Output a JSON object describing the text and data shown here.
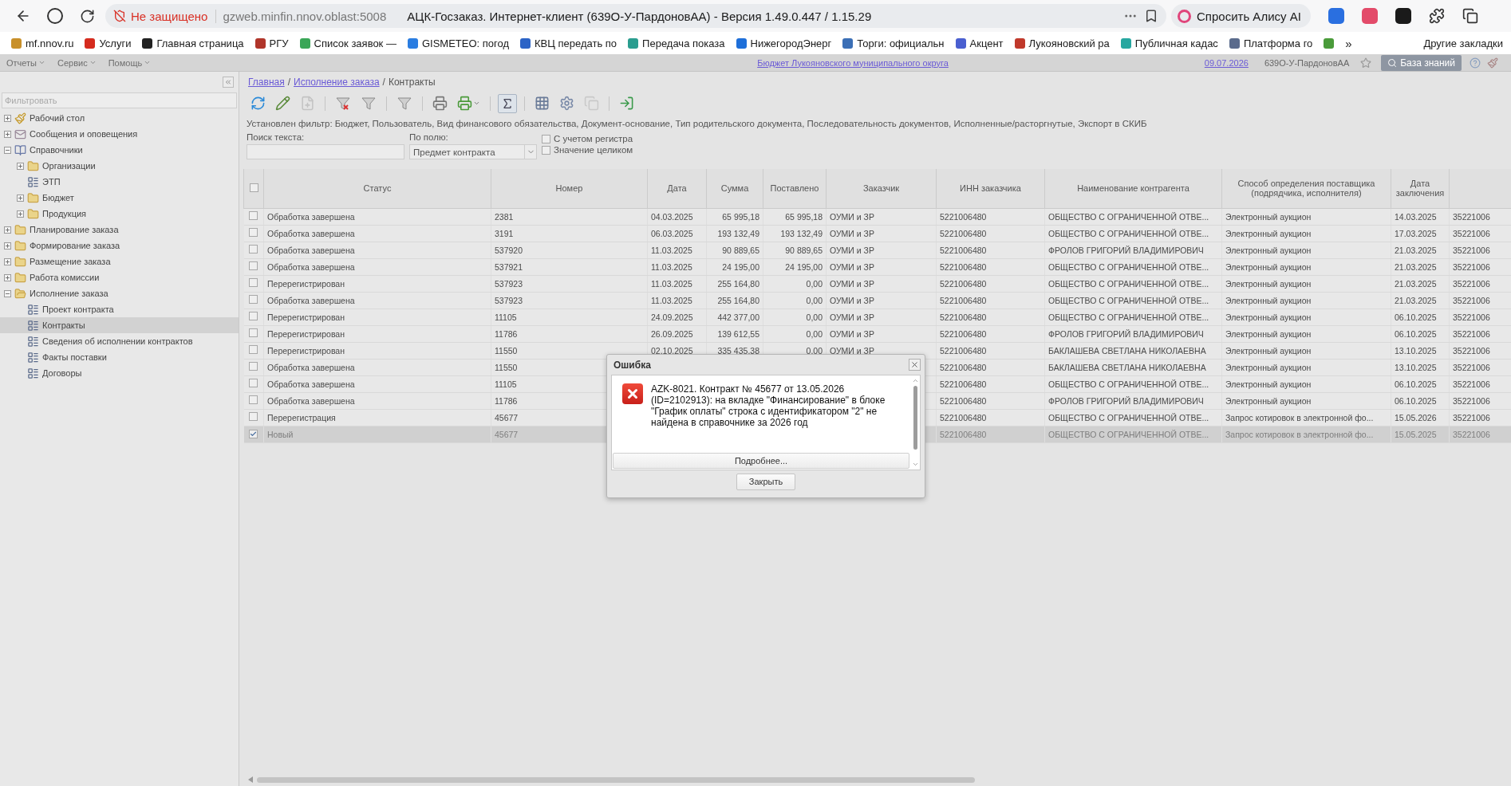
{
  "browser": {
    "security": "Не защищено",
    "url": "gzweb.minfin.nnov.oblast:5008",
    "title": "АЦК-Госзаказ. Интернет-клиент (639О-У-ПардоновАА) - Версия 1.49.0.447 / 1.15.29",
    "alice_button": "Спросить Алису AI"
  },
  "bookmarks": [
    {
      "label": "mf.nnov.ru",
      "color": "#c8902a"
    },
    {
      "label": "Услуги",
      "color": "#d52b1e"
    },
    {
      "label": "Главная страница",
      "color": "#222222"
    },
    {
      "label": "РГУ",
      "color": "#b0352a"
    },
    {
      "label": "Список заявок —",
      "color": "#3aa657"
    },
    {
      "label": "GISMETEO: погод",
      "color": "#2a7de1"
    },
    {
      "label": "КВЦ передать по",
      "color": "#2b63c6"
    },
    {
      "label": "Передача показа",
      "color": "#2a9d8f"
    },
    {
      "label": "НижегородЭнерг",
      "color": "#1e6fd9"
    },
    {
      "label": "Торги: официальн",
      "color": "#3b6fb6"
    },
    {
      "label": "Акцент",
      "color": "#4a5fd0"
    },
    {
      "label": "Лукояновский ра",
      "color": "#c0392b"
    },
    {
      "label": "Публичная кадас",
      "color": "#27a7a0"
    },
    {
      "label": "Платформа го",
      "color": "#5a6b8c"
    },
    {
      "color": "#4a9b3a"
    }
  ],
  "bookmarks_overflow": "»",
  "other_bookmarks": "Другие закладки",
  "menu": [
    {
      "label": "Отчеты"
    },
    {
      "label": "Сервис"
    },
    {
      "label": "Помощь"
    }
  ],
  "header": {
    "budget_link": "Бюджет Лукояновского муниципального округа",
    "date_link": "09.07.2026",
    "user": "639О-У-ПардоновАА",
    "knowledge_button": "База знаний"
  },
  "sidebar": {
    "filter_placeholder": "Фильтровать",
    "items": [
      {
        "label": "Рабочий стол",
        "kind": "desk",
        "expanded": false,
        "selected": false
      },
      {
        "label": "Сообщения и оповещения",
        "kind": "mail",
        "expanded": false,
        "selected": false
      },
      {
        "label": "Справочники",
        "kind": "books",
        "expanded": true,
        "selected": false,
        "children": [
          {
            "label": "Организации",
            "kind": "folder",
            "expanded": false,
            "selected": false
          },
          {
            "label": "ЭТП",
            "kind": "document",
            "selected": false
          },
          {
            "label": "Бюджет",
            "kind": "folder",
            "expanded": false,
            "selected": false
          },
          {
            "label": "Продукция",
            "kind": "folder",
            "expanded": false,
            "selected": false
          }
        ]
      },
      {
        "label": "Планирование заказа",
        "kind": "folder",
        "expanded": false,
        "selected": false
      },
      {
        "label": "Формирование заказа",
        "kind": "folder",
        "expanded": false,
        "selected": false
      },
      {
        "label": "Размещение заказа",
        "kind": "folder",
        "expanded": false,
        "selected": false
      },
      {
        "label": "Работа комиссии",
        "kind": "folder",
        "expanded": false,
        "selected": false
      },
      {
        "label": "Исполнение заказа",
        "kind": "folder",
        "expanded": true,
        "selected": false,
        "children": [
          {
            "label": "Проект контракта",
            "kind": "document",
            "selected": false
          },
          {
            "label": "Контракты",
            "kind": "document",
            "selected": true
          },
          {
            "label": "Сведения об исполнении контрактов",
            "kind": "document",
            "selected": false
          },
          {
            "label": "Факты поставки",
            "kind": "document",
            "selected": false
          },
          {
            "label": "Договоры",
            "kind": "document",
            "selected": false
          }
        ]
      }
    ]
  },
  "breadcrumb": [
    {
      "kind": "link",
      "label": "Главная"
    },
    {
      "kind": "separator",
      "label": "/"
    },
    {
      "kind": "link",
      "label": "Исполнение заказа"
    },
    {
      "kind": "separator",
      "label": "/"
    },
    {
      "kind": "current",
      "label": "Контракты"
    }
  ],
  "toolbar": [
    {
      "kind": "refresh",
      "disabled": false,
      "pressed": false
    },
    {
      "kind": "edit",
      "disabled": false,
      "pressed": false
    },
    {
      "kind": "new",
      "disabled": true,
      "pressed": false
    },
    {
      "kind": "separator"
    },
    {
      "kind": "filter-clear",
      "disabled": false,
      "pressed": false
    },
    {
      "kind": "filter",
      "disabled": false,
      "pressed": false
    },
    {
      "kind": "separator"
    },
    {
      "kind": "filter",
      "disabled": false,
      "pressed": false
    },
    {
      "kind": "separator"
    },
    {
      "kind": "print",
      "disabled": false,
      "pressed": false
    },
    {
      "kind": "print-send",
      "disabled": false,
      "pressed": false
    },
    {
      "kind": "separator"
    },
    {
      "kind": "sum",
      "disabled": false,
      "pressed": true
    },
    {
      "kind": "separator"
    },
    {
      "kind": "grid-search",
      "disabled": false,
      "pressed": false
    },
    {
      "kind": "settings",
      "disabled": false,
      "pressed": false
    },
    {
      "kind": "document",
      "disabled": true,
      "pressed": false
    },
    {
      "kind": "separator"
    },
    {
      "kind": "exit",
      "disabled": false,
      "pressed": false
    }
  ],
  "filter_info": "Установлен фильтр: Бюджет, Пользователь, Вид финансового обязательства, Документ-основание, Тип родительского документа, Последовательность документов, Исполненные/расторгнутые, Экспорт в СКИБ",
  "search": {
    "label": "Поиск текста:"
  },
  "field_select": {
    "label": "По полю:",
    "value": "Предмет контракта"
  },
  "options": [
    {
      "label": "С учетом регистра",
      "checked": false
    },
    {
      "label": "Значение целиком",
      "checked": false
    }
  ],
  "table": {
    "header_checked": false,
    "columns": [
      "Статус",
      "Номер",
      "Дата",
      "Сумма",
      "Поставлено",
      "Заказчик",
      "ИНН заказчика",
      "Наименование контрагента",
      "Способ определения поставщика (подрядчика, исполнителя)",
      "Дата заключения"
    ],
    "rows": [
      {
        "checked": false,
        "selected": false,
        "cells": [
          "Обработка завершена",
          "2381",
          "04.03.2025",
          "65 995,18",
          "65 995,18",
          "ОУМИ и ЗР",
          "5221006480",
          "ОБЩЕСТВО С ОГРАНИЧЕННОЙ ОТВЕ...",
          "Электронный аукцион",
          "14.03.2025",
          "35221006"
        ]
      },
      {
        "checked": false,
        "selected": false,
        "cells": [
          "Обработка завершена",
          "3191",
          "06.03.2025",
          "193 132,49",
          "193 132,49",
          "ОУМИ и ЗР",
          "5221006480",
          "ОБЩЕСТВО С ОГРАНИЧЕННОЙ ОТВЕ...",
          "Электронный аукцион",
          "17.03.2025",
          "35221006"
        ]
      },
      {
        "checked": false,
        "selected": false,
        "cells": [
          "Обработка завершена",
          "537920",
          "11.03.2025",
          "90 889,65",
          "90 889,65",
          "ОУМИ и ЗР",
          "5221006480",
          "ФРОЛОВ ГРИГОРИЙ ВЛАДИМИРОВИЧ",
          "Электронный аукцион",
          "21.03.2025",
          "35221006"
        ]
      },
      {
        "checked": false,
        "selected": false,
        "cells": [
          "Обработка завершена",
          "537921",
          "11.03.2025",
          "24 195,00",
          "24 195,00",
          "ОУМИ и ЗР",
          "5221006480",
          "ОБЩЕСТВО С ОГРАНИЧЕННОЙ ОТВЕ...",
          "Электронный аукцион",
          "21.03.2025",
          "35221006"
        ]
      },
      {
        "checked": false,
        "selected": false,
        "cells": [
          "Перерегистрирован",
          "537923",
          "11.03.2025",
          "255 164,80",
          "0,00",
          "ОУМИ и ЗР",
          "5221006480",
          "ОБЩЕСТВО С ОГРАНИЧЕННОЙ ОТВЕ...",
          "Электронный аукцион",
          "21.03.2025",
          "35221006"
        ]
      },
      {
        "checked": false,
        "selected": false,
        "cells": [
          "Обработка завершена",
          "537923",
          "11.03.2025",
          "255 164,80",
          "0,00",
          "ОУМИ и ЗР",
          "5221006480",
          "ОБЩЕСТВО С ОГРАНИЧЕННОЙ ОТВЕ...",
          "Электронный аукцион",
          "21.03.2025",
          "35221006"
        ]
      },
      {
        "checked": false,
        "selected": false,
        "cells": [
          "Перерегистрирован",
          "11105",
          "24.09.2025",
          "442 377,00",
          "0,00",
          "ОУМИ и ЗР",
          "5221006480",
          "ОБЩЕСТВО С ОГРАНИЧЕННОЙ ОТВЕ...",
          "Электронный аукцион",
          "06.10.2025",
          "35221006"
        ]
      },
      {
        "checked": false,
        "selected": false,
        "cells": [
          "Перерегистрирован",
          "11786",
          "26.09.2025",
          "139 612,55",
          "0,00",
          "ОУМИ и ЗР",
          "5221006480",
          "ФРОЛОВ ГРИГОРИЙ ВЛАДИМИРОВИЧ",
          "Электронный аукцион",
          "06.10.2025",
          "35221006"
        ]
      },
      {
        "checked": false,
        "selected": false,
        "cells": [
          "Перерегистрирован",
          "11550",
          "02.10.2025",
          "335 435,38",
          "0,00",
          "ОУМИ и ЗР",
          "5221006480",
          "БАКЛАШЕВА СВЕТЛАНА НИКОЛАЕВНА",
          "Электронный аукцион",
          "13.10.2025",
          "35221006"
        ]
      },
      {
        "checked": false,
        "selected": false,
        "cells": [
          "Обработка завершена",
          "11550",
          null,
          null,
          null,
          null,
          "5221006480",
          "БАКЛАШЕВА СВЕТЛАНА НИКОЛАЕВНА",
          "Электронный аукцион",
          "13.10.2025",
          "35221006"
        ]
      },
      {
        "checked": false,
        "selected": false,
        "cells": [
          "Обработка завершена",
          "11105",
          null,
          null,
          null,
          null,
          "5221006480",
          "ОБЩЕСТВО С ОГРАНИЧЕННОЙ ОТВЕ...",
          "Электронный аукцион",
          "06.10.2025",
          "35221006"
        ]
      },
      {
        "checked": false,
        "selected": false,
        "cells": [
          "Обработка завершена",
          "11786",
          null,
          null,
          null,
          null,
          "5221006480",
          "ФРОЛОВ ГРИГОРИЙ ВЛАДИМИРОВИЧ",
          "Электронный аукцион",
          "06.10.2025",
          "35221006"
        ]
      },
      {
        "checked": false,
        "selected": false,
        "cells": [
          "Перерегистрация",
          "45677",
          null,
          null,
          null,
          null,
          "5221006480",
          "ОБЩЕСТВО С ОГРАНИЧЕННОЙ ОТВЕ...",
          "Запрос котировок в электронной фо...",
          "15.05.2026",
          "35221006"
        ]
      },
      {
        "checked": true,
        "selected": true,
        "cells": [
          "Новый",
          "45677",
          null,
          null,
          null,
          null,
          "5221006480",
          "ОБЩЕСТВО С ОГРАНИЧЕННОЙ ОТВЕ...",
          "Запрос котировок в электронной фо...",
          "15.05.2025",
          "35221006"
        ]
      }
    ]
  },
  "dialog": {
    "title": "Ошибка",
    "message": "AZK-8021. Контракт № 45677 от 13.05.2026 (ID=2102913): на вкладке \"Финансирование\" в блоке \"График оплаты\" строка с идентификатором \"2\" не найдена в справочнике за 2026 год",
    "details_button": "Подробнее...",
    "close_button": "Закрыть"
  }
}
